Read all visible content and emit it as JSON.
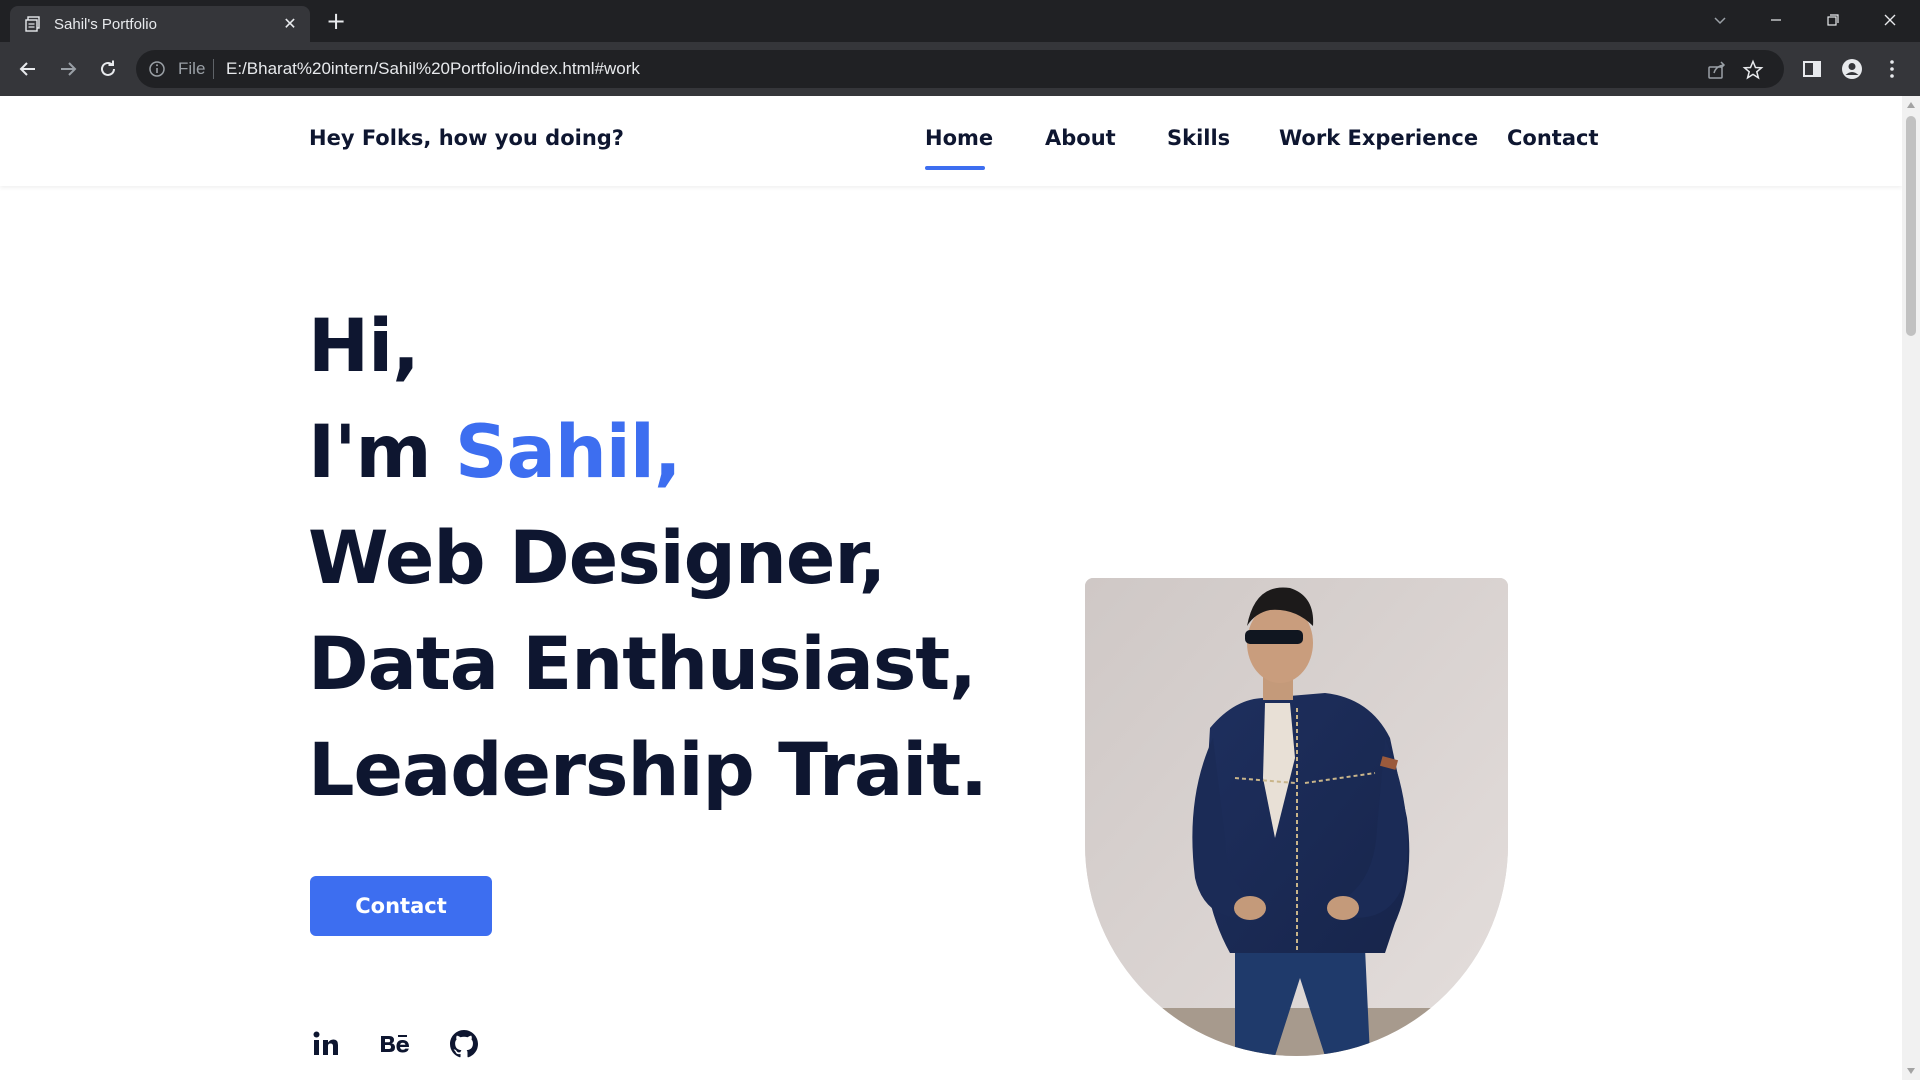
{
  "browser": {
    "tab_title": "Sahil's Portfolio",
    "file_label": "File",
    "url": "E:/Bharat%20intern/Sahil%20Portfolio/index.html#work"
  },
  "header": {
    "greeting": "Hey Folks, how you doing?",
    "nav": [
      "Home",
      "About",
      "Skills",
      "Work Experience",
      "Contact"
    ],
    "active": "Home"
  },
  "hero": {
    "line1": "Hi,",
    "line2_prefix": "I'm ",
    "line2_name": "Sahil,",
    "line3": "Web Designer,",
    "line4": "Data Enthusiast,",
    "line5": "Leadership Trait.",
    "contact_button": "Contact"
  },
  "social": {
    "linkedin": "in",
    "behance": "Bē",
    "github": "github-icon"
  },
  "colors": {
    "accent": "#3d6ef0",
    "text_dark": "#0e1630",
    "chrome_dark": "#202124",
    "chrome_toolbar": "#35363a"
  }
}
